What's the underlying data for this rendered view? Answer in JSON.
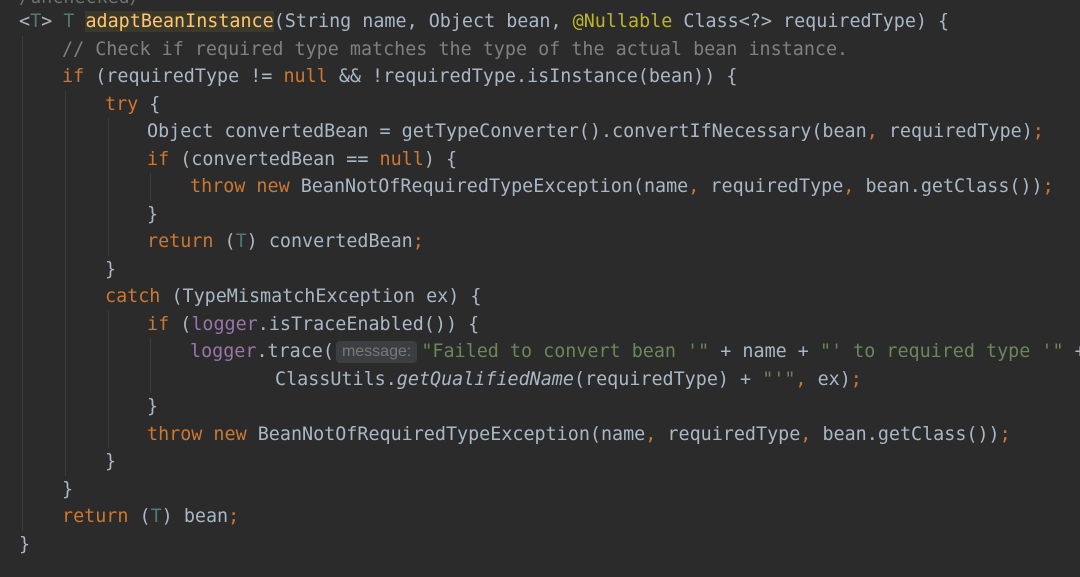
{
  "editor": {
    "annotation_fragment": "/unchecked/",
    "lines": [
      {
        "name": "line-method-signature",
        "tokens": [
          {
            "t": "<",
            "c": ""
          },
          {
            "t": "T",
            "c": "tp"
          },
          {
            "t": "> ",
            "c": ""
          },
          {
            "t": "T",
            "c": "tp"
          },
          {
            "t": " ",
            "c": ""
          },
          {
            "t": "adaptBeanInstance",
            "c": "fn",
            "name": "method-name-adaptBeanInstance"
          },
          {
            "t": "(String name, Object bean, ",
            "c": ""
          },
          {
            "t": "@Nullable",
            "c": "ann"
          },
          {
            "t": " Class<?> requiredType) {",
            "c": ""
          }
        ]
      },
      {
        "name": "line-comment",
        "tokens": [
          {
            "t": "// Check if required type matches the type of the actual bean instance.",
            "c": "cm"
          }
        ]
      },
      {
        "name": "line-if-required-type",
        "tokens": [
          {
            "t": "if",
            "c": "kw"
          },
          {
            "t": " (requiredType != ",
            "c": ""
          },
          {
            "t": "null",
            "c": "kw"
          },
          {
            "t": " && !requiredType.isInstance(bean)) {",
            "c": ""
          }
        ]
      },
      {
        "name": "line-try",
        "tokens": [
          {
            "t": "try",
            "c": "kw"
          },
          {
            "t": " {",
            "c": ""
          }
        ]
      },
      {
        "name": "line-converted-bean",
        "tokens": [
          {
            "t": "Object convertedBean = getTypeConverter().convertIfNecessary(bean",
            "c": ""
          },
          {
            "t": ", ",
            "c": "kw"
          },
          {
            "t": "requiredType)",
            "c": ""
          },
          {
            "t": ";",
            "c": "kw"
          }
        ]
      },
      {
        "name": "line-if-null",
        "tokens": [
          {
            "t": "if",
            "c": "kw"
          },
          {
            "t": " (convertedBean == ",
            "c": ""
          },
          {
            "t": "null",
            "c": "kw"
          },
          {
            "t": ") {",
            "c": ""
          }
        ]
      },
      {
        "name": "line-throw-1",
        "tokens": [
          {
            "t": "throw new",
            "c": "kw"
          },
          {
            "t": " BeanNotOfRequiredTypeException(name",
            "c": ""
          },
          {
            "t": ", ",
            "c": "kw"
          },
          {
            "t": "requiredType",
            "c": ""
          },
          {
            "t": ", ",
            "c": "kw"
          },
          {
            "t": "bean.getClass())",
            "c": ""
          },
          {
            "t": ";",
            "c": "kw"
          }
        ]
      },
      {
        "name": "line-close-if",
        "tokens": [
          {
            "t": "}",
            "c": ""
          }
        ]
      },
      {
        "name": "line-return-converted",
        "tokens": [
          {
            "t": "return",
            "c": "kw"
          },
          {
            "t": " (",
            "c": ""
          },
          {
            "t": "T",
            "c": "tp"
          },
          {
            "t": ") convertedBean",
            "c": ""
          },
          {
            "t": ";",
            "c": "kw"
          }
        ]
      },
      {
        "name": "line-close-try",
        "tokens": [
          {
            "t": "}",
            "c": ""
          }
        ]
      },
      {
        "name": "line-catch",
        "tokens": [
          {
            "t": "catch",
            "c": "kw"
          },
          {
            "t": " (TypeMismatchException ex) {",
            "c": ""
          }
        ]
      },
      {
        "name": "line-if-trace",
        "tokens": [
          {
            "t": "if",
            "c": "kw"
          },
          {
            "t": " (",
            "c": ""
          },
          {
            "t": "logger",
            "c": "fld"
          },
          {
            "t": ".isTraceEnabled()) {",
            "c": ""
          }
        ]
      },
      {
        "name": "line-logger-trace",
        "tokens": [
          {
            "t": "logger",
            "c": "fld"
          },
          {
            "t": ".trace(",
            "c": ""
          },
          {
            "t": "message:",
            "c": "hint",
            "name": "parameter-hint-message"
          },
          {
            "t": "\"Failed to convert bean '\"",
            "c": "str"
          },
          {
            "t": " + name + ",
            "c": ""
          },
          {
            "t": "\"' to required type '\"",
            "c": "str"
          },
          {
            "t": " +",
            "c": ""
          }
        ]
      },
      {
        "name": "line-qualified-name",
        "tokens": [
          {
            "t": "ClassUtils.",
            "c": ""
          },
          {
            "t": "getQualifiedName",
            "c": "it"
          },
          {
            "t": "(requiredType) + ",
            "c": ""
          },
          {
            "t": "\"'\"",
            "c": "str"
          },
          {
            "t": ", ",
            "c": "kw"
          },
          {
            "t": "ex)",
            "c": ""
          },
          {
            "t": ";",
            "c": "kw"
          }
        ]
      },
      {
        "name": "line-close-if-trace",
        "tokens": [
          {
            "t": "}",
            "c": ""
          }
        ]
      },
      {
        "name": "line-throw-2",
        "tokens": [
          {
            "t": "throw new",
            "c": "kw"
          },
          {
            "t": " BeanNotOfRequiredTypeException(name",
            "c": ""
          },
          {
            "t": ", ",
            "c": "kw"
          },
          {
            "t": "requiredType",
            "c": ""
          },
          {
            "t": ", ",
            "c": "kw"
          },
          {
            "t": "bean.getClass())",
            "c": ""
          },
          {
            "t": ";",
            "c": "kw"
          }
        ]
      },
      {
        "name": "line-close-catch",
        "tokens": [
          {
            "t": "}",
            "c": ""
          }
        ]
      },
      {
        "name": "line-close-outer-if",
        "tokens": [
          {
            "t": "}",
            "c": ""
          }
        ]
      },
      {
        "name": "line-return-bean",
        "tokens": [
          {
            "t": "return",
            "c": "kw"
          },
          {
            "t": " (",
            "c": ""
          },
          {
            "t": "T",
            "c": "tp"
          },
          {
            "t": ") bean",
            "c": ""
          },
          {
            "t": ";",
            "c": "kw"
          }
        ]
      },
      {
        "name": "line-close-method",
        "tokens": [
          {
            "t": "}",
            "c": ""
          }
        ]
      }
    ]
  },
  "colors": {
    "background": "#2b2b2b",
    "default_text": "#a9b7c6",
    "keyword": "#cc7832",
    "comment": "#808080",
    "string": "#6a8759",
    "annotation": "#bbb529",
    "type_parameter": "#507874",
    "method_declaration": "#ffc66d",
    "field": "#9876aa"
  }
}
